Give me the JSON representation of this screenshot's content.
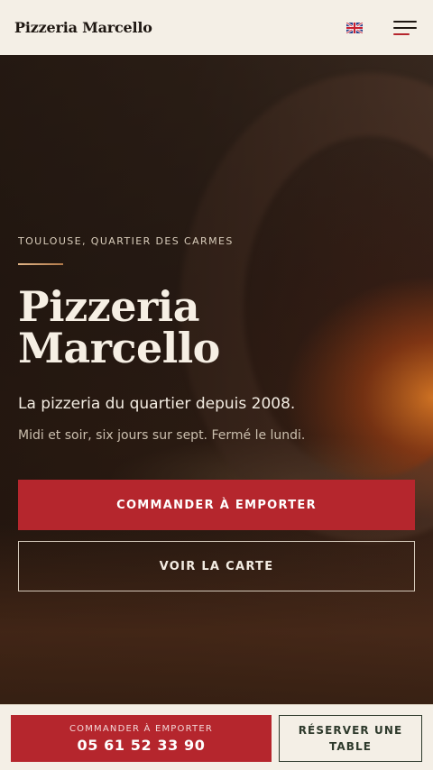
{
  "header": {
    "brand": "Pizzeria Marcello",
    "language_icon": "uk-flag-icon",
    "menu_icon": "hamburger-menu-icon"
  },
  "hero": {
    "eyebrow": "TOULOUSE, QUARTIER DES CARMES",
    "title_line1": "Pizzeria",
    "title_line2": "Marcello",
    "tagline": "La pizzeria du quartier depuis 2008.",
    "hours": "Midi et soir, six jours sur sept. Fermé le lundi.",
    "primary_button": "COMMANDER À EMPORTER",
    "secondary_button": "VOIR LA CARTE"
  },
  "bottom_bar": {
    "order_label": "COMMANDER À EMPORTER",
    "order_phone": "05 61 52 33 90",
    "reserve_label": "RÉSERVER UNE TABLE"
  },
  "colors": {
    "accent_red": "#b5262d",
    "cream": "#f4efe6",
    "dark_green": "#2e3a2c"
  }
}
